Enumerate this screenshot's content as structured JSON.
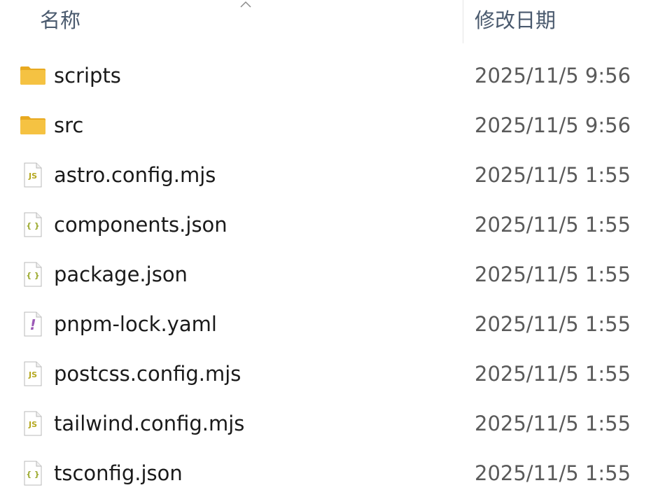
{
  "header": {
    "name_label": "名称",
    "date_label": "修改日期"
  },
  "files": [
    {
      "name": "scripts",
      "date": "2025/11/5 9:56",
      "icon": "folder-icon"
    },
    {
      "name": "src",
      "date": "2025/11/5 9:56",
      "icon": "folder-icon"
    },
    {
      "name": "astro.config.mjs",
      "date": "2025/11/5 1:55",
      "icon": "js-file-icon"
    },
    {
      "name": "components.json",
      "date": "2025/11/5 1:55",
      "icon": "json-file-icon"
    },
    {
      "name": "package.json",
      "date": "2025/11/5 1:55",
      "icon": "json-file-icon"
    },
    {
      "name": "pnpm-lock.yaml",
      "date": "2025/11/5 1:55",
      "icon": "yaml-file-icon"
    },
    {
      "name": "postcss.config.mjs",
      "date": "2025/11/5 1:55",
      "icon": "js-file-icon"
    },
    {
      "name": "tailwind.config.mjs",
      "date": "2025/11/5 1:55",
      "icon": "js-file-icon"
    },
    {
      "name": "tsconfig.json",
      "date": "2025/11/5 1:55",
      "icon": "json-file-icon"
    }
  ],
  "colors": {
    "folder": "#f5c242",
    "js_accent": "#b5a81f",
    "json_accent": "#9aa82a",
    "yaml_accent": "#9b59b6"
  }
}
